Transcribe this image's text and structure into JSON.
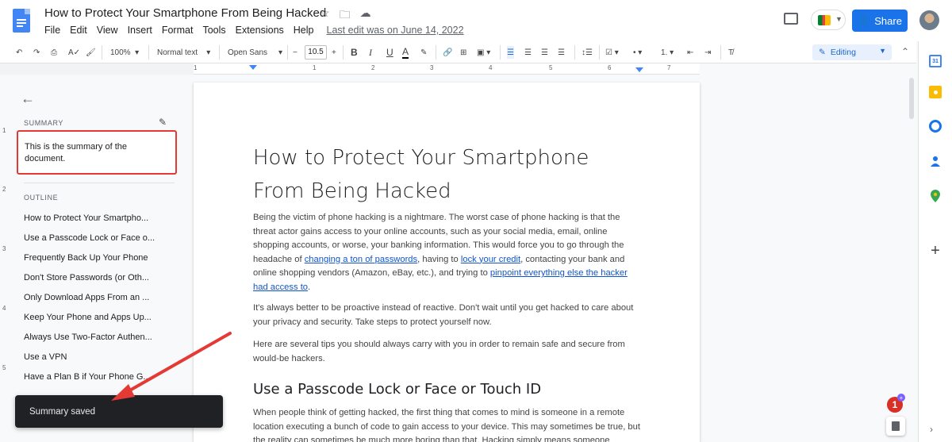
{
  "document": {
    "title": "How to Protect Your Smartphone From Being Hacked",
    "last_edit": "Last edit was on June 14, 2022"
  },
  "menu": [
    "File",
    "Edit",
    "View",
    "Insert",
    "Format",
    "Tools",
    "Extensions",
    "Help"
  ],
  "header": {
    "share_label": "Share"
  },
  "toolbar": {
    "zoom": "100%",
    "style": "Normal text",
    "font": "Open Sans",
    "font_size": "10.5",
    "mode": "Editing"
  },
  "ruler": [
    "1",
    "1",
    "2",
    "3",
    "4",
    "5",
    "6",
    "7"
  ],
  "vruler": [
    "1",
    "2",
    "3",
    "4",
    "5"
  ],
  "outline_panel": {
    "summary_label": "SUMMARY",
    "summary_text": "This is the summary of the document.",
    "outline_label": "OUTLINE",
    "items": [
      "How to Protect Your Smartpho...",
      "Use a Passcode Lock or Face o...",
      "Frequently Back Up Your Phone",
      "Don't Store Passwords (or Oth...",
      "Only Download Apps From an ...",
      "Keep Your Phone and Apps Up...",
      "Always Use Two-Factor Authen...",
      "Use a VPN",
      "Have a Plan B if Your Phone G..."
    ]
  },
  "toast": {
    "message": "Summary saved"
  },
  "content": {
    "title": "How to Protect Your Smartphone From Being Hacked",
    "p1_a": "Being the victim of phone hacking is a nightmare. The worst case of phone hacking is that the threat actor gains access to your online accounts, such as your social media, email, online shopping accounts, or worse, your banking information. This would force you to go through the headache of ",
    "p1_link1": "changing a ton of passwords",
    "p1_b": ", having to ",
    "p1_link2": "lock your credit",
    "p1_c": ", contacting your bank and online shopping vendors (Amazon, eBay, etc.), and trying to ",
    "p1_link3": "pinpoint everything else the hacker had access to",
    "p1_d": ".",
    "p2": "It's always better to be proactive instead of reactive. Don't wait until you get hacked to care about your privacy and security. Take steps to protect yourself now.",
    "p3": "Here are several tips you should always carry with you in order to remain safe and secure from would-be hackers.",
    "h2": "Use a Passcode Lock or Face or Touch ID",
    "p4": "When people think of getting hacked, the first thing that comes to mind is someone in a remote location executing a bunch of code to gain access to your device. This may sometimes be true, but the reality can sometimes be much more boring than that. Hacking simply means someone"
  },
  "notifications": {
    "count": "1"
  },
  "colors": {
    "brand_blue": "#1a73e8",
    "highlight_red": "#e53935",
    "link": "#1155cc"
  }
}
